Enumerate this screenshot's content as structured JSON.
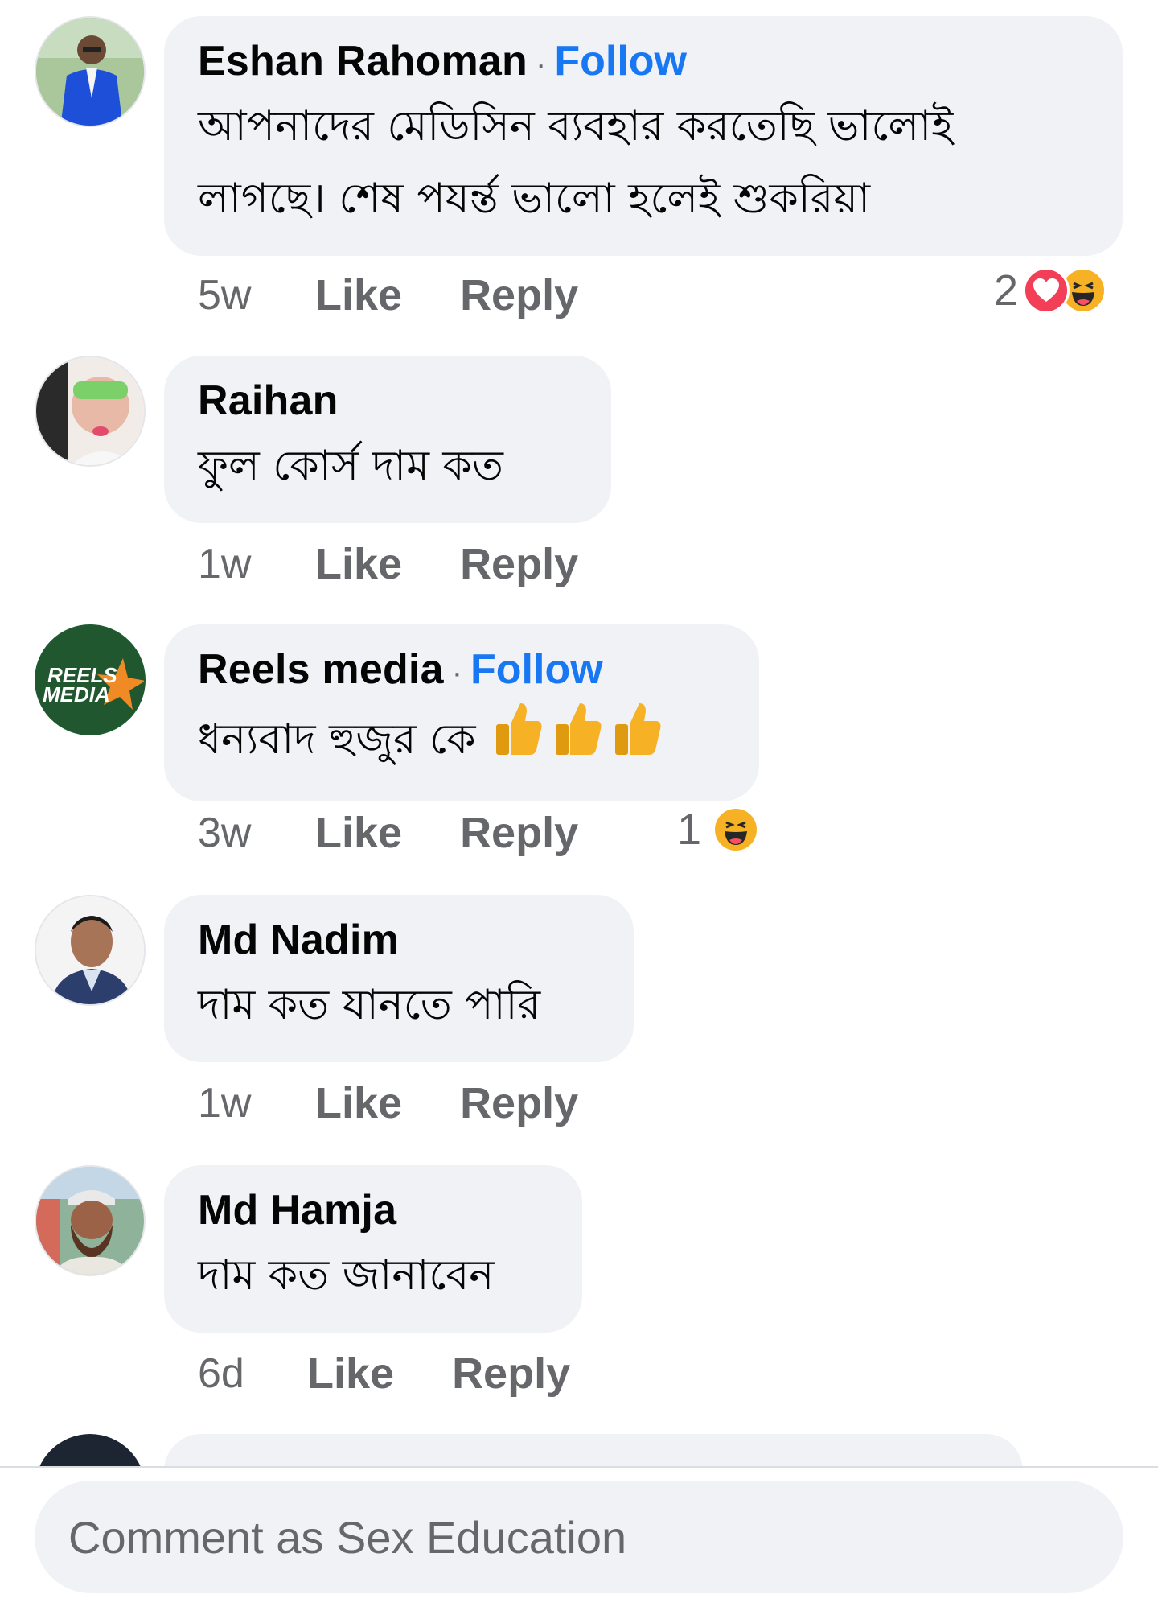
{
  "comments": [
    {
      "name": "Eshan Rahoman",
      "follow": "Follow",
      "separator": "·",
      "text_line1": "আপনাদের মেডিসিন ব্যবহার করতেছি ভালোই",
      "text_line2": "লাগছে। শেষ পযর্ন্ত ভালো হলেই শুকরিয়া",
      "time": "5w",
      "like": "Like",
      "reply": "Reply",
      "reaction_count": "2",
      "reactions": [
        "love-icon",
        "haha-icon"
      ]
    },
    {
      "name": "Raihan",
      "text": "ফুল কোর্স  দাম কত",
      "time": "1w",
      "like": "Like",
      "reply": "Reply"
    },
    {
      "name": "Reels media",
      "follow": "Follow",
      "separator": "·",
      "text": "ধন্যবাদ হুজুর কে",
      "emoji": [
        "thumbs-up-icon",
        "thumbs-up-icon",
        "thumbs-up-icon"
      ],
      "avatar_text_line1": "REELS",
      "avatar_text_line2": "MEDIA",
      "time": "3w",
      "like": "Like",
      "reply": "Reply",
      "reaction_count": "1",
      "reactions": [
        "haha-icon"
      ]
    },
    {
      "name": "Md Nadim",
      "text": "দাম কত যানতে পারি",
      "time": "1w",
      "like": "Like",
      "reply": "Reply"
    },
    {
      "name": "Md Hamja",
      "text": "দাম কত জানাবেন",
      "time": "6d",
      "like": "Like",
      "reply": "Reply"
    }
  ],
  "composer": {
    "placeholder": "Comment as Sex Education"
  },
  "colors": {
    "accent": "#1877f2",
    "bubble": "#f0f2f5",
    "secondary_text": "#65676b",
    "love": "#f33e58",
    "haha": "#f7b125"
  }
}
